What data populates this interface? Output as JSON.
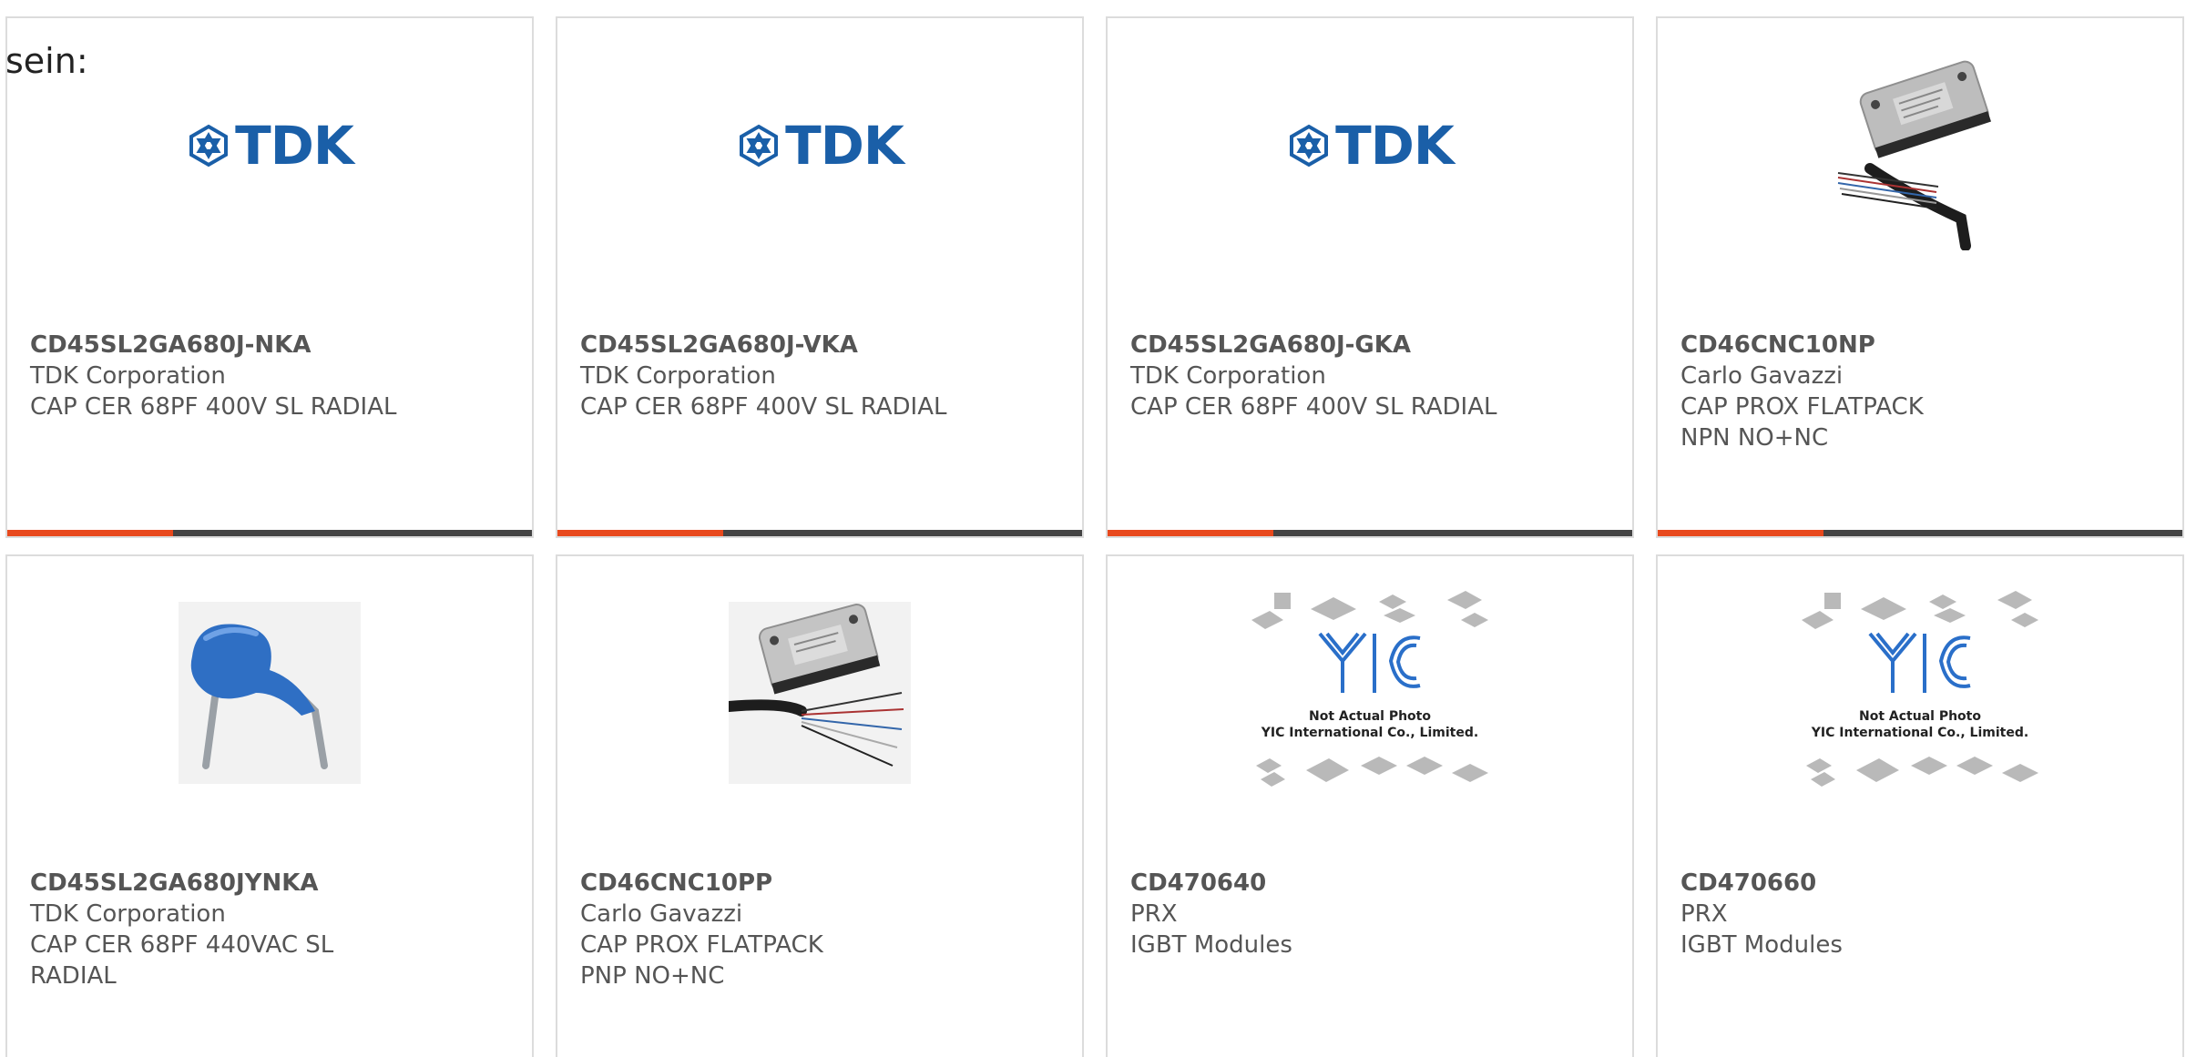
{
  "lead_text": "sein:",
  "colors": {
    "accent": "#e8491d",
    "bar": "#444444",
    "tdk_blue": "#1a5fa8",
    "yic_blue": "#2a6fc9",
    "card_border": "#dcdcdc",
    "text": "#555555"
  },
  "cards": [
    {
      "part_number": "CD45SL2GA680J-NKA",
      "manufacturer": "TDK Corporation",
      "description": "CAP CER 68PF 400V SL RADIAL",
      "image": "tdk-logo",
      "logo_text": "TDK"
    },
    {
      "part_number": "CD45SL2GA680J-VKA",
      "manufacturer": "TDK Corporation",
      "description": "CAP CER 68PF 400V SL RADIAL",
      "image": "tdk-logo",
      "logo_text": "TDK"
    },
    {
      "part_number": "CD45SL2GA680J-GKA",
      "manufacturer": "TDK Corporation",
      "description": "CAP CER 68PF 400V SL RADIAL",
      "image": "tdk-logo",
      "logo_text": "TDK"
    },
    {
      "part_number": "CD46CNC10NP",
      "manufacturer": "Carlo Gavazzi",
      "description": "CAP PROX FLATPACK NPN NO+NC",
      "image": "proximity-sensor-photo"
    },
    {
      "part_number": "CD45SL2GA680JYNKA",
      "manufacturer": "TDK Corporation",
      "description": "CAP CER 68PF 440VAC SL RADIAL",
      "image": "ceramic-capacitor-photo"
    },
    {
      "part_number": "CD46CNC10PP",
      "manufacturer": "Carlo Gavazzi",
      "description": "CAP PROX FLATPACK PNP NO+NC",
      "image": "proximity-sensor-photo"
    },
    {
      "part_number": "CD470640",
      "manufacturer": "PRX",
      "description": "IGBT Modules",
      "image": "placeholder-photo",
      "placeholder_line1": "Not Actual Photo",
      "placeholder_line2": "YIC International Co., Limited."
    },
    {
      "part_number": "CD470660",
      "manufacturer": "PRX",
      "description": "IGBT Modules",
      "image": "placeholder-photo",
      "placeholder_line1": "Not Actual Photo",
      "placeholder_line2": "YIC International Co., Limited."
    }
  ]
}
